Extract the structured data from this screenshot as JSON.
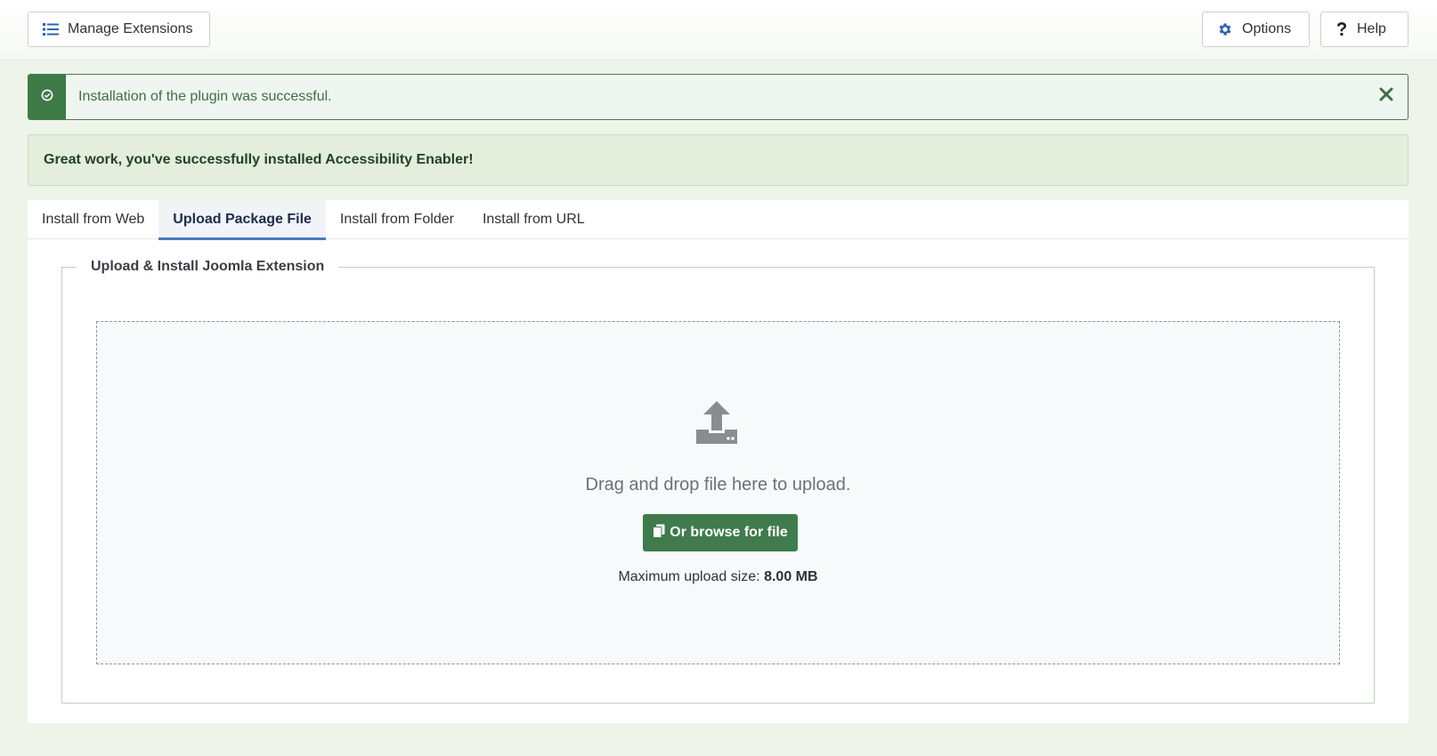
{
  "toolbar": {
    "manage_label": "Manage Extensions",
    "options_label": "Options",
    "help_label": "Help",
    "icons": {
      "manage": "list-icon",
      "options": "gear-icon",
      "help": "question-icon"
    }
  },
  "alert": {
    "text": "Installation of the plugin was successful.",
    "icon": "check-circle-icon",
    "close_icon": "close-icon"
  },
  "message": {
    "text": "Great work, you've successfully installed Accessibility Enabler!"
  },
  "tabs": [
    {
      "label": "Install from Web",
      "active": false
    },
    {
      "label": "Upload Package File",
      "active": true
    },
    {
      "label": "Install from Folder",
      "active": false
    },
    {
      "label": "Install from URL",
      "active": false
    }
  ],
  "upload": {
    "legend": "Upload & Install Joomla Extension",
    "drag_text": "Drag and drop file here to upload.",
    "browse_label": "Or browse for file",
    "max_size_label": "Maximum upload size:",
    "max_size_value": "8.00 MB",
    "upload_icon": "upload-icon",
    "browse_icon": "copy-icon"
  },
  "colors": {
    "accent_green": "#3f7b4d",
    "alert_green": "#3d7a46",
    "tab_active_underline": "#4a7ac0",
    "gear_blue": "#2f63b0",
    "page_background": "#eef4ea"
  }
}
